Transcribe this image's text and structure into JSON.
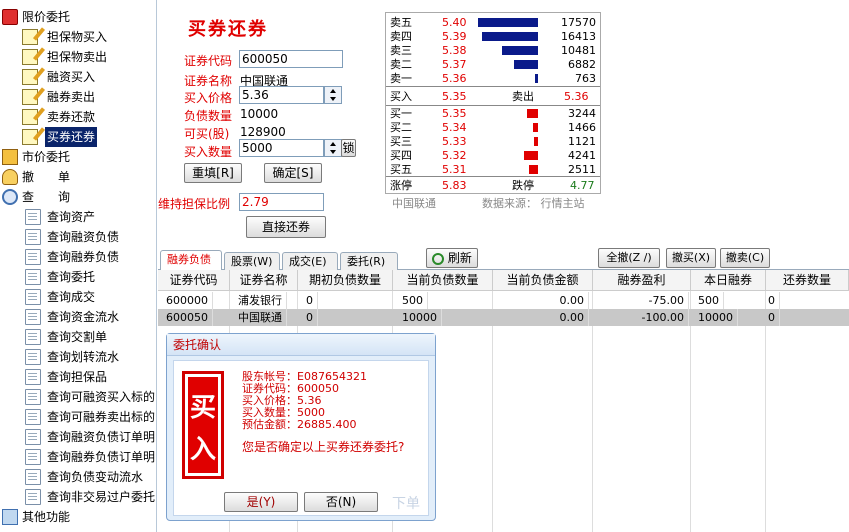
{
  "sidebar": {
    "groups": [
      {
        "label": "限价委托"
      },
      {
        "label": "市价委托"
      },
      {
        "label": "撤　　单"
      },
      {
        "label": "查　　询"
      },
      {
        "label": "其他功能"
      }
    ],
    "credit_items": [
      "担保物买入",
      "担保物卖出",
      "融资买入",
      "融券卖出",
      "卖券还款",
      "买券还券"
    ],
    "query_items": [
      "查询资产",
      "查询融资负债",
      "查询融券负债",
      "查询委托",
      "查询成交",
      "查询资金流水",
      "查询交割单",
      "查询划转流水",
      "查询担保品",
      "查询可融资买入标的",
      "查询可融券卖出标的",
      "查询融资负债订单明",
      "查询融券负债订单明",
      "查询负债变动流水",
      "查询非交易过户委托"
    ]
  },
  "form": {
    "title": "买券还券",
    "code_label": "证券代码",
    "code_value": "600050",
    "name_label": "证券名称",
    "name_value": "中国联通",
    "price_label": "买入价格",
    "price_value": "5.36",
    "debt_label": "负债数量",
    "debt_value": "10000",
    "canbuy_label": "可买(股)",
    "canbuy_value": "128900",
    "qty_label": "买入数量",
    "qty_value": "5000",
    "lock_label": "锁",
    "reset_btn": "重填[R]",
    "ok_btn": "确定[S]",
    "ratio_label": "维持担保比例",
    "ratio_value": "2.79",
    "repay_btn": "直接还券"
  },
  "book": {
    "sell": [
      {
        "name": "卖五",
        "price": "5.40",
        "vol": "17570"
      },
      {
        "name": "卖四",
        "price": "5.39",
        "vol": "16413"
      },
      {
        "name": "卖三",
        "price": "5.38",
        "vol": "10481"
      },
      {
        "name": "卖二",
        "price": "5.37",
        "vol": "6882"
      },
      {
        "name": "卖一",
        "price": "5.36",
        "vol": "763"
      }
    ],
    "buy_label": "买入",
    "buy_price": "5.35",
    "sell_label": "卖出",
    "sell_price": "5.36",
    "buy": [
      {
        "name": "买一",
        "price": "5.35",
        "vol": "3244"
      },
      {
        "name": "买二",
        "price": "5.34",
        "vol": "1466"
      },
      {
        "name": "买三",
        "price": "5.33",
        "vol": "1121"
      },
      {
        "name": "买四",
        "price": "5.32",
        "vol": "4241"
      },
      {
        "name": "买五",
        "price": "5.31",
        "vol": "2511"
      }
    ],
    "up_label": "涨停",
    "up_price": "5.83",
    "down_label": "跌停",
    "down_price": "4.77",
    "footer_name": "中国联通",
    "footer_src": "数据来源： 行情主站",
    "sell_color": "#0a1a8a",
    "buy_color": "#e00000"
  },
  "tabs": {
    "items": [
      "融券负债",
      "股票(W)",
      "成交(E)",
      "委托(R)"
    ],
    "refresh": "刷新",
    "cancel_all": "全撤(Z /)",
    "cancel_buy": "撤买(X)",
    "cancel_sell": "撤卖(C)"
  },
  "grid": {
    "headers": [
      "证券代码",
      "证券名称",
      "期初负债数量",
      "当前负债数量",
      "当前负债金额",
      "融券盈利",
      "本日融券",
      "还券数量"
    ],
    "rows": [
      [
        "600000",
        "浦发银行",
        "0",
        "500",
        "0.00",
        "-75.00",
        "500",
        "0"
      ],
      [
        "600050",
        "中国联通",
        "0",
        "10000",
        "0.00",
        "-100.00",
        "10000",
        "0"
      ]
    ]
  },
  "dialog": {
    "title": "委托确认",
    "stamp_top": "买",
    "stamp_bottom": "入",
    "account": "股东帐号：E087654321",
    "code": "证券代码：600050",
    "price": "买入价格：5.36",
    "qty": "买入数量：5000",
    "amount": "预估金额：26885.400",
    "question": "您是否确定以上买券还券委托?",
    "yes": "是(Y)",
    "no": "否(N)",
    "watermark": "下单"
  }
}
